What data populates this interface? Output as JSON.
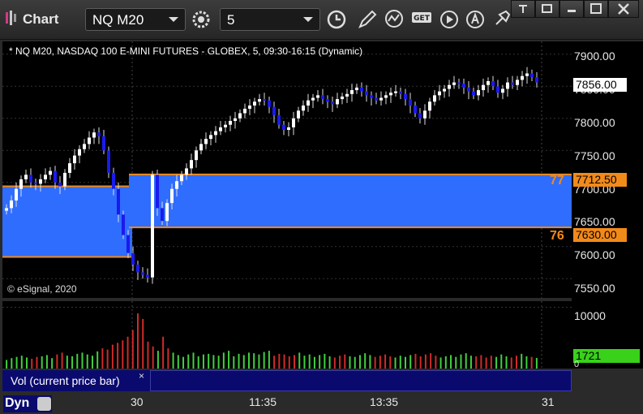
{
  "window": {
    "title": "Chart"
  },
  "toolbar": {
    "symbol": "NQ M20",
    "interval": "5",
    "icons": [
      "settings-gear-icon",
      "clock-icon",
      "pencil-icon",
      "study-icon",
      "get-icon",
      "play-icon",
      "alert-icon",
      "cursor-icon"
    ]
  },
  "chart": {
    "header": "* NQ M20, NASDAQ 100 E-MINI FUTURES - GLOBEX, 5, 09:30-16:15 (Dynamic)",
    "copyright": "© eSignal, 2020",
    "price_ticks": [
      "7900.00",
      "7850.00",
      "7800.00",
      "7750.00",
      "7700.00",
      "7650.00",
      "7600.00",
      "7550.00"
    ],
    "last_price": "7856.00",
    "levels": [
      {
        "label": "77",
        "price": "7712.50",
        "value": 7712.5
      },
      {
        "label": "76",
        "price": "7630.00",
        "value": 7630.0
      }
    ],
    "zone_prev": {
      "top": 7694,
      "bottom": 7584
    },
    "time_ticks": [
      "30",
      "11:35",
      "13:35",
      "31"
    ],
    "colors": {
      "zone": "#2f6dff",
      "level": "#f28a1a",
      "up": "#ffffff",
      "down": "#1a1aee",
      "vol_up": "#3fd13f",
      "vol_down": "#d12a2a",
      "panel": "#0a0a6e"
    }
  },
  "volume": {
    "label": "Vol (current price bar)",
    "close": "×",
    "ticks": [
      "10000",
      "0"
    ],
    "current": "1721"
  },
  "bottom": {
    "mode": "Dyn"
  },
  "chart_data": {
    "type": "candlestick",
    "title": "* NQ M20, NASDAQ 100 E-MINI FUTURES - GLOBEX, 5, 09:30-16:15 (Dynamic)",
    "y_ticks": [
      7900,
      7850,
      7800,
      7750,
      7700,
      7650,
      7600,
      7550
    ],
    "ylim": [
      7520,
      7920
    ],
    "x_ticks": [
      "30",
      "11:35",
      "13:35",
      "31"
    ],
    "last_price": 7856.0,
    "levels": [
      7712.5,
      7630.0
    ],
    "close_series": [
      7660,
      7672,
      7690,
      7705,
      7712,
      7700,
      7698,
      7705,
      7712,
      7718,
      7700,
      7694,
      7715,
      7730,
      7742,
      7752,
      7760,
      7770,
      7778,
      7772,
      7750,
      7715,
      7690,
      7650,
      7618,
      7590,
      7572,
      7560,
      7556,
      7552,
      7712,
      7660,
      7640,
      7668,
      7690,
      7702,
      7712,
      7722,
      7735,
      7750,
      7760,
      7768,
      7774,
      7780,
      7786,
      7790,
      7796,
      7800,
      7808,
      7815,
      7820,
      7826,
      7830,
      7828,
      7818,
      7805,
      7790,
      7782,
      7786,
      7800,
      7812,
      7820,
      7828,
      7832,
      7836,
      7830,
      7826,
      7822,
      7830,
      7834,
      7838,
      7844,
      7848,
      7842,
      7836,
      7832,
      7828,
      7832,
      7836,
      7840,
      7842,
      7838,
      7830,
      7820,
      7808,
      7800,
      7812,
      7826,
      7836,
      7842,
      7846,
      7852,
      7856,
      7854,
      7848,
      7842,
      7836,
      7844,
      7852,
      7858,
      7850,
      7840,
      7846,
      7856,
      7852,
      7860,
      7866,
      7870,
      7864,
      7856
    ],
    "volume_series": [
      1400,
      1700,
      1900,
      2100,
      1800,
      1600,
      1900,
      2000,
      2200,
      1700,
      2300,
      2600,
      2100,
      2000,
      2400,
      2600,
      2300,
      2100,
      2800,
      3300,
      3100,
      3900,
      4200,
      4600,
      5200,
      6300,
      9000,
      8100,
      4400,
      3600,
      2900,
      5200,
      3300,
      2600,
      2200,
      1900,
      2300,
      2600,
      2000,
      2300,
      2400,
      2200,
      2100,
      2600,
      2900,
      2000,
      2400,
      2200,
      2600,
      2500,
      2300,
      2700,
      2900,
      2100,
      2400,
      2300,
      2000,
      2200,
      2600,
      2100,
      2300,
      1900,
      2200,
      2400,
      2000,
      1800,
      2100,
      2300,
      2000,
      1900,
      2200,
      2500,
      2200,
      1900,
      2100,
      2300,
      2000,
      1800,
      2100,
      1900,
      2200,
      2400,
      2000,
      2300,
      2500,
      2100,
      1800,
      2000,
      2200,
      1900,
      2300,
      2500,
      2100,
      2000,
      2200,
      1800,
      2100,
      1900,
      2300,
      2000,
      1800,
      2100,
      2400,
      2000,
      1900,
      1721
    ],
    "vol_ylim": [
      0,
      11000
    ]
  }
}
